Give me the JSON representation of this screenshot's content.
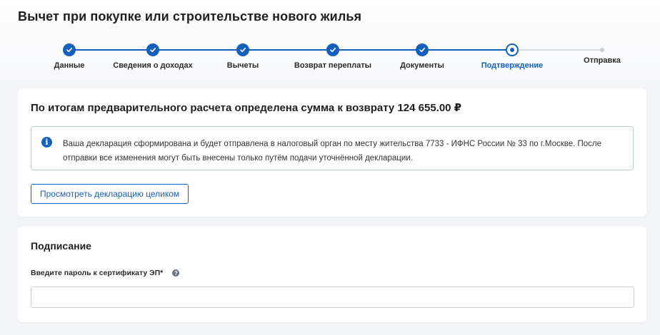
{
  "page": {
    "title": "Вычет при покупке или строительстве нового жилья"
  },
  "stepper": {
    "steps": [
      {
        "label": "Данные",
        "state": "done"
      },
      {
        "label": "Сведения о доходах",
        "state": "done"
      },
      {
        "label": "Вычеты",
        "state": "done"
      },
      {
        "label": "Возврат переплаты",
        "state": "done"
      },
      {
        "label": "Документы",
        "state": "done"
      },
      {
        "label": "Подтверждение",
        "state": "current"
      },
      {
        "label": "Отправка",
        "state": "todo"
      }
    ]
  },
  "summary": {
    "title": "По итогам предварительного расчета определена сумма к возврату 124 655.00 ₽",
    "info_icon": "info-icon",
    "info_text": "Ваша декларация сформирована и будет отправлена в налоговый орган по месту жительства 7733 - ИФНС России № 33 по г.Москве. После отправки все изменения могут быть внесены только путём подачи уточнённой декларации.",
    "view_button_label": "Просмотреть декларацию целиком"
  },
  "signing": {
    "title": "Подписание",
    "password_label": "Введите пароль к сертификату ЭП*",
    "help_icon": "question-icon",
    "password_value": "",
    "password_placeholder": ""
  },
  "colors": {
    "accent": "#1560bd",
    "background": "#f2f4f7",
    "card": "#ffffff",
    "info_border": "#b8cce8"
  }
}
